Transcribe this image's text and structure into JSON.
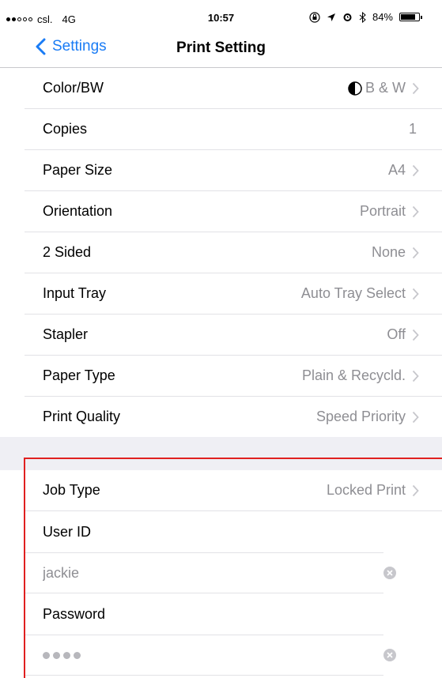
{
  "status_bar": {
    "carrier": "csl.",
    "network": "4G",
    "time": "10:57",
    "battery_percent": "84%",
    "battery_level": 0.84,
    "signal_bars_filled": 2,
    "signal_bars_total": 5
  },
  "nav": {
    "back_label": "Settings",
    "title": "Print Setting"
  },
  "settings": [
    {
      "label": "Color/BW",
      "value": "B & W",
      "icon": "half-circle-icon",
      "chevron": true
    },
    {
      "label": "Copies",
      "value": "1",
      "chevron": false
    },
    {
      "label": "Paper Size",
      "value": "A4",
      "chevron": true
    },
    {
      "label": "Orientation",
      "value": "Portrait",
      "chevron": true
    },
    {
      "label": "2 Sided",
      "value": "None",
      "chevron": true
    },
    {
      "label": "Input Tray",
      "value": "Auto Tray Select",
      "chevron": true
    },
    {
      "label": "Stapler",
      "value": "Off",
      "chevron": true
    },
    {
      "label": "Paper Type",
      "value": "Plain & Recycld.",
      "chevron": true
    },
    {
      "label": "Print Quality",
      "value": "Speed Priority",
      "chevron": true
    }
  ],
  "job": {
    "job_type_label": "Job Type",
    "job_type_value": "Locked Print",
    "user_id_label": "User ID",
    "user_id_value": "jackie",
    "password_label": "Password",
    "password_dot_count": 4
  },
  "colors": {
    "accent": "#1a7cf5",
    "highlight": "#e02020",
    "secondary_text": "#8e8e93"
  }
}
